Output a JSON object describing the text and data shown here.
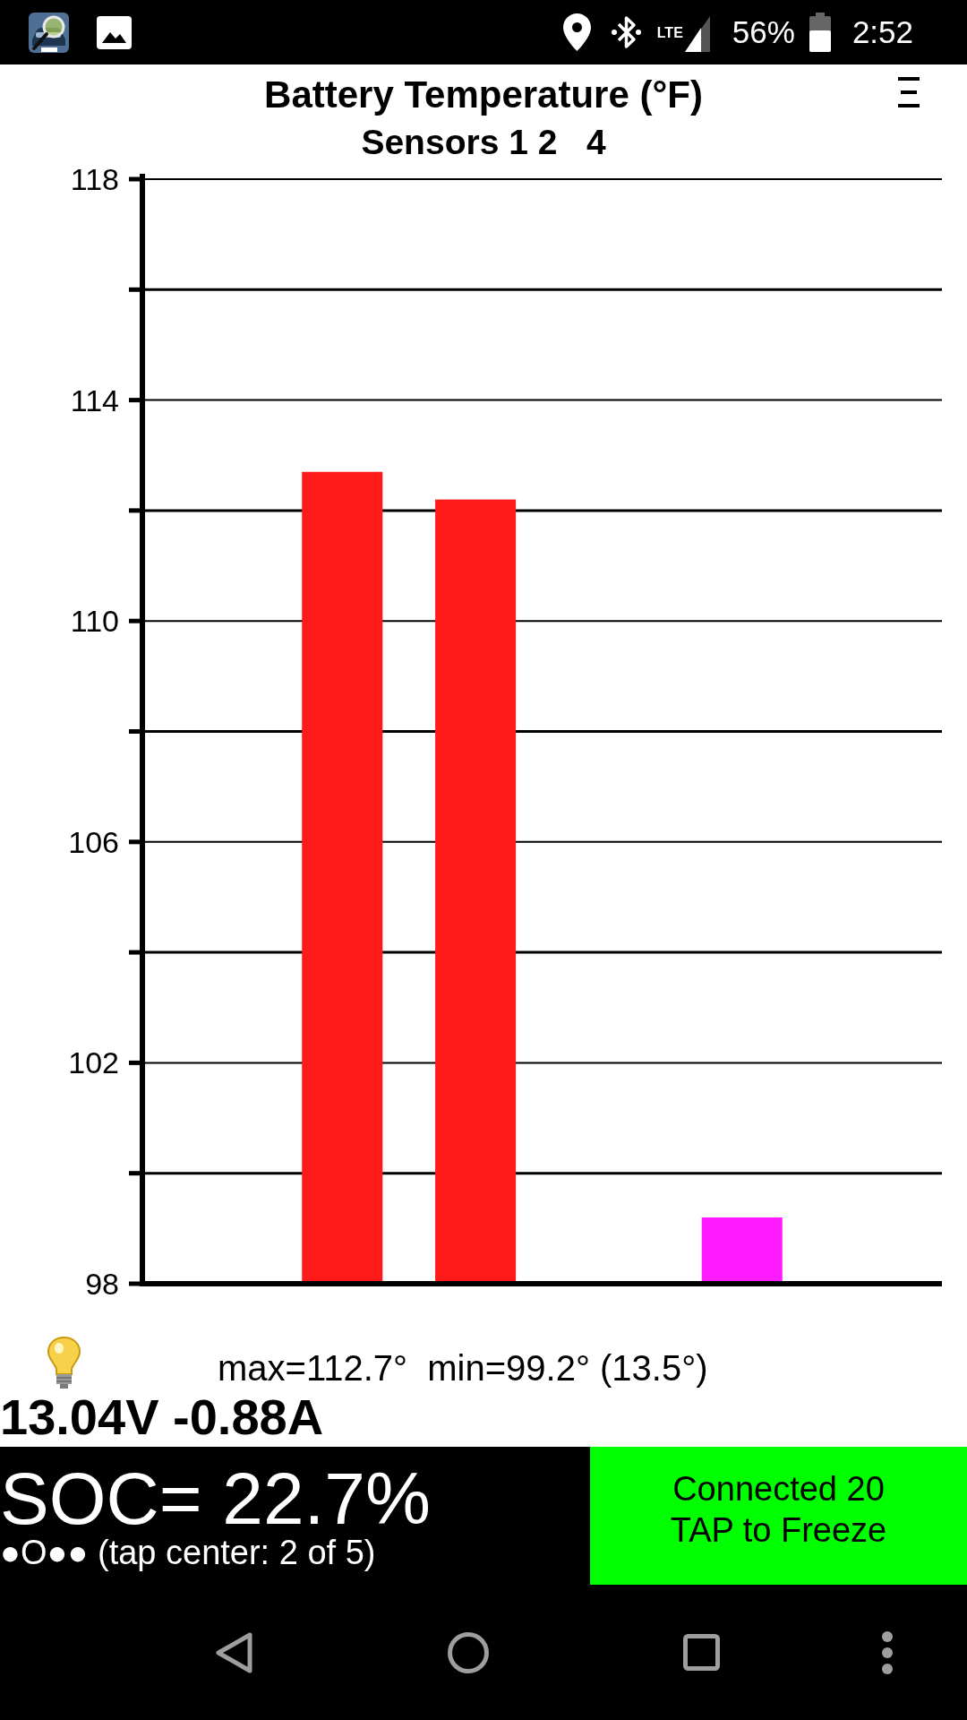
{
  "status_bar": {
    "network": "LTE",
    "battery": "56%",
    "time": "2:52"
  },
  "header": {
    "title": "Battery Temperature (°F)",
    "subtitle": "Sensors 1 2   4"
  },
  "chart": {
    "chart_data": {
      "type": "bar",
      "categories": [
        null,
        null,
        null,
        null,
        null,
        null
      ],
      "values": [
        null,
        112.7,
        112.2,
        null,
        99.2,
        null
      ],
      "colors": [
        null,
        "#ff1a1a",
        "#ff1a1a",
        null,
        "#ff1aff",
        null
      ],
      "ylim": [
        98,
        118
      ],
      "yticks": [
        98,
        102,
        106,
        110,
        114,
        118
      ],
      "grid": true
    }
  },
  "stats": "max=112.7°  min=99.2° (13.5°)",
  "electrical": "13.04V -0.88A",
  "soc": "SOC= 22.7%",
  "page_hint": "●O●● (tap center: 2 of 5)",
  "status_button": {
    "lines": [
      "Connected 20",
      "TAP to Freeze"
    ]
  }
}
